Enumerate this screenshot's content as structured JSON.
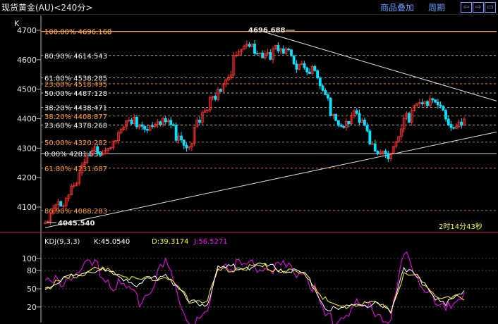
{
  "header": {
    "title": "现货黄金(AU)<240分>",
    "overlay_label": "商品叠加",
    "period_label": "周期",
    "nav_buttons": [
      "⇦",
      "⇨",
      "▭"
    ],
    "panel_letter": "K"
  },
  "main_chart": {
    "yticks": [
      4100,
      4200,
      4300,
      4400,
      4500,
      4600,
      4700
    ],
    "high_label": "4696.688",
    "low_label": "4045.540",
    "countdown": "2时14分43秒",
    "white_fib": [
      {
        "text": "100.00% 4696.168",
        "price": 4696.2
      },
      {
        "text": "80.90% 4614.543",
        "price": 4614.5
      },
      {
        "text": "61.80% 4538.285",
        "price": 4538.3
      },
      {
        "text": "50.00% 4487.128",
        "price": 4487.1
      },
      {
        "text": "38.20% 4438.471",
        "price": 4438.5
      },
      {
        "text": "23.60% 4378.268",
        "price": 4378.3
      },
      {
        "text": "0.00% 4281.559",
        "price": 4281.6
      }
    ],
    "orange_fib": [
      {
        "text": "100.00% 4696.168",
        "price": 4696.2
      },
      {
        "text": "23.60% 4518.495",
        "price": 4518.5
      },
      {
        "text": "38.20% 4408.877",
        "price": 4408.9
      },
      {
        "text": "50.00% 4320.282",
        "price": 4320.3
      },
      {
        "text": "61.80% 4231.687",
        "price": 4231.7
      },
      {
        "text": "80.90% 4088.283",
        "price": 4088.3
      }
    ]
  },
  "kdj": {
    "title": "KDJ(9,3,3)",
    "k_label": "K:45.0540",
    "d_label": "D:39.3174",
    "j_label": "J:56.5271",
    "yticks": [
      20,
      50,
      80,
      100
    ]
  },
  "colors": {
    "up": "#ff3030",
    "down": "#00e5ff",
    "k": "#ffffff",
    "d": "#ffff00",
    "j": "#ff00ff",
    "fib_white": "#cfcfcf",
    "fib_orange": "#ff9933",
    "link": "#6a9cff"
  },
  "chart_data": {
    "type": "candlestick",
    "symbol": "现货黄金(AU)",
    "interval": "240分",
    "ylim": [
      4040,
      4720
    ],
    "anchors": {
      "x_index": [
        0,
        18,
        28,
        36,
        46,
        55,
        62,
        66,
        75,
        86,
        100,
        107,
        112,
        118,
        127,
        132,
        137,
        142,
        149,
        153,
        160
      ],
      "close": [
        4045,
        4300,
        4360,
        4410,
        4390,
        4340,
        4440,
        4520,
        4650,
        4640,
        4600,
        4480,
        4400,
        4420,
        4320,
        4290,
        4390,
        4490,
        4460,
        4400,
        4420
      ],
      "k": [
        55,
        85,
        75,
        60,
        80,
        30,
        30,
        85,
        90,
        90,
        75,
        25,
        15,
        30,
        25,
        15,
        90,
        70,
        40,
        30,
        45.05
      ],
      "d": [
        55,
        85,
        80,
        65,
        75,
        35,
        35,
        80,
        90,
        88,
        75,
        35,
        20,
        30,
        28,
        18,
        75,
        72,
        45,
        35,
        39.32
      ],
      "j": [
        60,
        95,
        60,
        40,
        95,
        5,
        10,
        100,
        95,
        95,
        85,
        5,
        10,
        30,
        20,
        5,
        110,
        80,
        30,
        20,
        56.53
      ]
    }
  }
}
